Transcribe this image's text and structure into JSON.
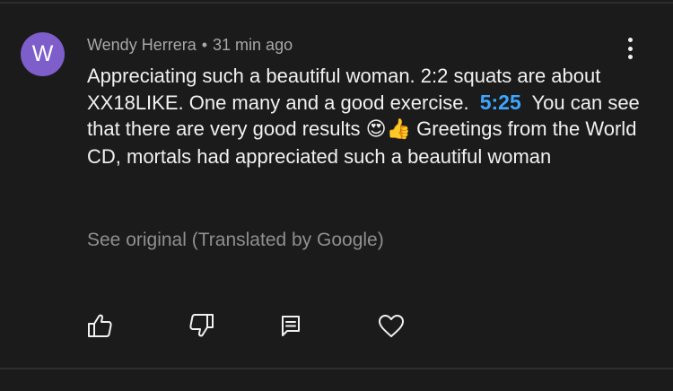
{
  "comment": {
    "avatar_letter": "W",
    "avatar_color": "#7d5ecb",
    "author": "Wendy Herrera",
    "separator": "•",
    "time": "31 min ago",
    "text_line1": "Appreciating such a beautiful woman. 2:2 squats are about XX18LIKE. One many and a good exercise.",
    "timestamp_link": "5:25",
    "text_line2": "You can see that there are very good results",
    "emojis": "😍👍",
    "text_line3": "Greetings from the World CD, mortals had appreciated such a beautiful woman",
    "see_original": "See original (Translated by Google)"
  },
  "actions": {
    "like_icon": "thumbs-up-icon",
    "dislike_icon": "thumbs-down-icon",
    "reply_icon": "reply-comment-icon",
    "heart_icon": "heart-icon"
  },
  "colors": {
    "background": "#1b1b1b",
    "text": "#f1f1f1",
    "meta_text": "#a8a8a8",
    "link": "#3ea6ff"
  }
}
